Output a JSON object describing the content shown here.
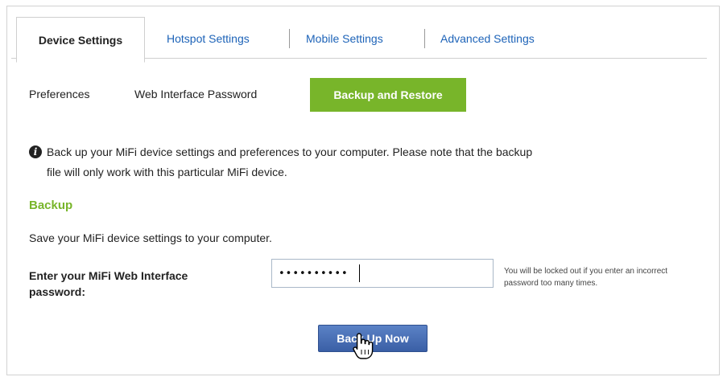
{
  "tabs": [
    {
      "label": "Device Settings",
      "active": true
    },
    {
      "label": "Hotspot Settings",
      "active": false
    },
    {
      "label": "Mobile Settings",
      "active": false
    },
    {
      "label": "Advanced Settings",
      "active": false
    }
  ],
  "subtabs": [
    {
      "label": "Preferences",
      "active": false
    },
    {
      "label": "Web Interface Password",
      "active": false
    },
    {
      "label": "Backup and Restore",
      "active": true
    }
  ],
  "info": {
    "icon": "info-icon",
    "line1": "Back up your MiFi device settings and preferences to your computer. Please note that the backup",
    "line2": "file will only work with this particular MiFi device."
  },
  "backup": {
    "title": "Backup",
    "description": "Save your MiFi device settings to your computer.",
    "password_label": "Enter your MiFi Web Interface password:",
    "password_value": "••••••••••",
    "hint": "You will be locked out if you enter an incorrect password too many times.",
    "button_label": "Back Up Now"
  },
  "colors": {
    "accent_green": "#78b52a",
    "link_blue": "#1d63b8",
    "button_blue": "#3a5fa6"
  }
}
